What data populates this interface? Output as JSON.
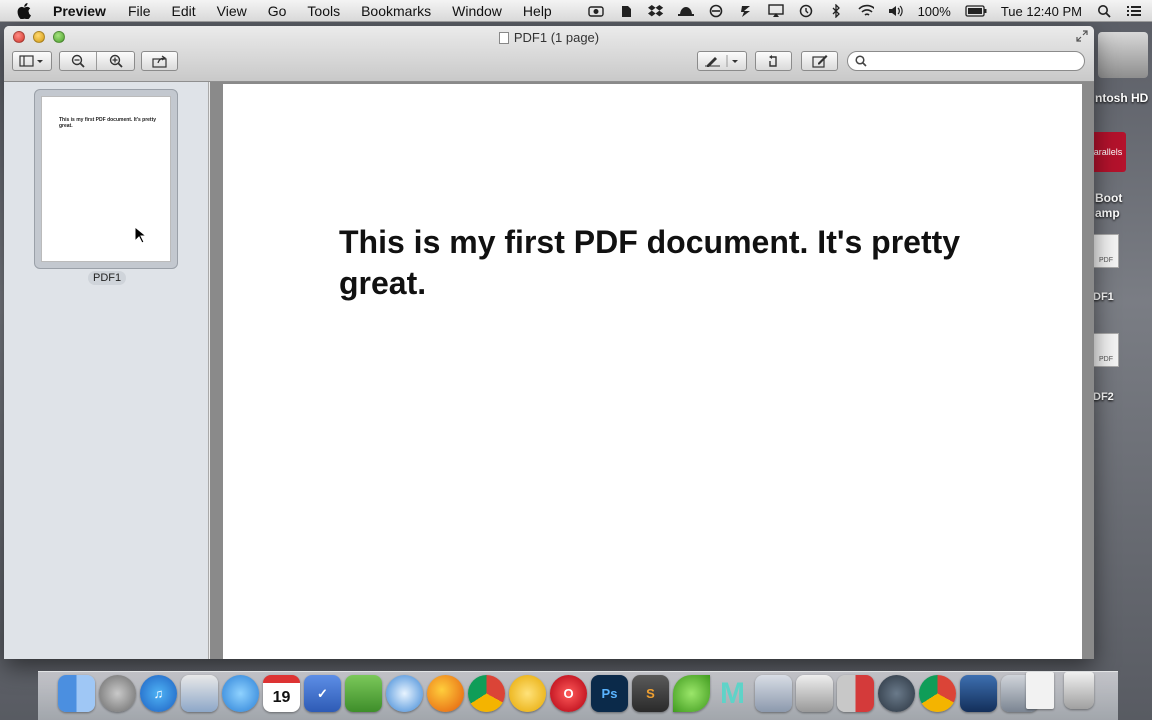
{
  "menubar": {
    "app_name": "Preview",
    "items": [
      "File",
      "Edit",
      "View",
      "Go",
      "Tools",
      "Bookmarks",
      "Window",
      "Help"
    ],
    "battery": "100%",
    "clock": "Tue 12:40 PM"
  },
  "window": {
    "title": "PDF1 (1 page)"
  },
  "sidebar": {
    "thumbnail_text": "This is my first PDF document. It's pretty great.",
    "thumbnail_label": "PDF1"
  },
  "document": {
    "text": "This is my first PDF document. It's pretty great."
  },
  "desktop": {
    "disk_label": "ntosh HD",
    "parallels_label": "arallels",
    "bootcamp_label": "Boot amp",
    "pdf1_label": "DF1",
    "pdf2_label": "DF2",
    "pdf_badge": "PDF"
  },
  "dock": {
    "calendar_day": "19",
    "photoshop_label": "Ps"
  }
}
